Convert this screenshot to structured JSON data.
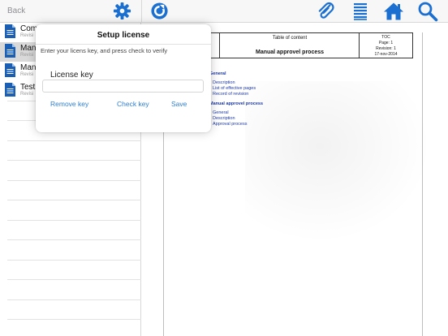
{
  "toolbar": {
    "back_label": "Back",
    "accent_color": "#1a6fd0"
  },
  "sidebar": {
    "items": [
      {
        "title": "Com",
        "subtitle": "Revisi",
        "selected": false
      },
      {
        "title": "Manu",
        "subtitle": "Revisi",
        "selected": true
      },
      {
        "title": "Manu",
        "subtitle": "Revisi",
        "selected": false
      },
      {
        "title": "Test",
        "subtitle": "Revisi",
        "selected": false
      }
    ]
  },
  "document": {
    "logo_text": "n",
    "logo_sub": "r",
    "header_title": "Table of content",
    "header_subtitle": "Manual approvel process",
    "meta": {
      "code": "TOC",
      "page": "Page: 1",
      "revision": "Revision: 1",
      "date": "17-nov-2014"
    },
    "toc": {
      "section1": "General",
      "section1_items": [
        "Description",
        "List of effective pages",
        "Record of revision"
      ],
      "section2": "Manual approvel process",
      "section2_items": [
        "General",
        "Description",
        "Approval process"
      ]
    }
  },
  "license_dialog": {
    "title": "Setup license",
    "instructions": "Enter your licens key, and press check to verify",
    "field_label": "License key",
    "field_value": "",
    "remove_label": "Remove key",
    "check_label": "Check key",
    "save_label": "Save"
  }
}
